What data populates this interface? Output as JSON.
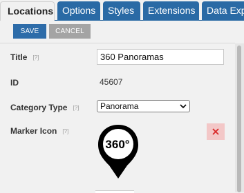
{
  "tabs": [
    {
      "label": "Locations",
      "active": true
    },
    {
      "label": "Options",
      "active": false
    },
    {
      "label": "Styles",
      "active": false
    },
    {
      "label": "Extensions",
      "active": false
    },
    {
      "label": "Data Expo",
      "active": false
    }
  ],
  "toolbar": {
    "save_label": "SAVE",
    "cancel_label": "CANCEL"
  },
  "form": {
    "help_marker": "[?]",
    "title_label": "Title",
    "title_value": "360 Panoramas",
    "id_label": "ID",
    "id_value": "45607",
    "category_label": "Category Type",
    "category_value": "Panorama",
    "marker_label": "Marker Icon",
    "marker_icon_text": "360°",
    "remove_symbol": "✕"
  },
  "colors": {
    "accent": "#2a6aa5",
    "save_button": "#2d6ca9",
    "cancel_button": "#a4a4a4",
    "remove_bg": "#f3c7c7",
    "remove_x": "#d92626"
  }
}
